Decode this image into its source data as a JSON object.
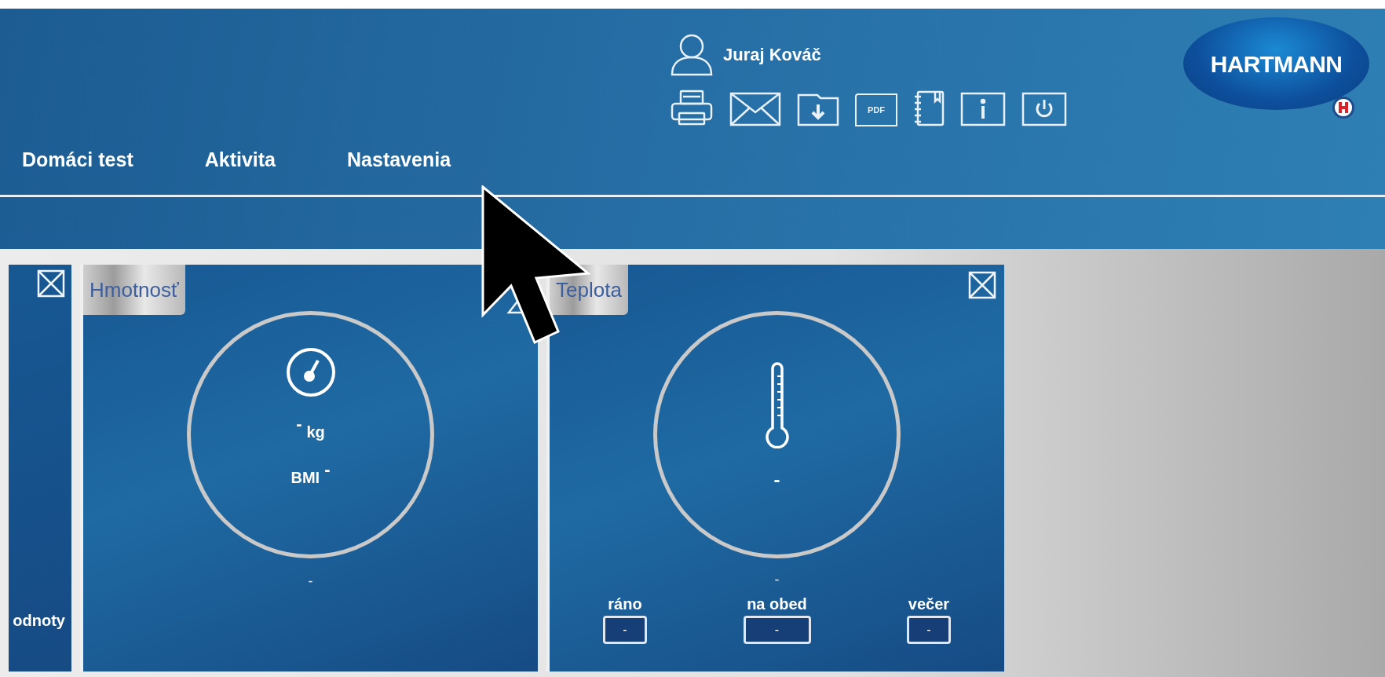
{
  "header": {
    "nav": [
      {
        "label": "Domáci test"
      },
      {
        "label": "Aktivita"
      },
      {
        "label": "Nastavenia"
      }
    ],
    "user": {
      "name": "Juraj Kováč"
    },
    "toolbar": [
      {
        "kind": "print"
      },
      {
        "kind": "mail"
      },
      {
        "kind": "download"
      },
      {
        "kind": "pdf",
        "label": "PDF"
      },
      {
        "kind": "notebook"
      },
      {
        "kind": "info"
      },
      {
        "kind": "power"
      }
    ],
    "logo": {
      "text": "HARTMANN"
    }
  },
  "cards": [
    {
      "kind": "partial",
      "footer": "odnoty"
    },
    {
      "kind": "weight",
      "title": "Hmotnosť",
      "value": "-",
      "unit": "kg",
      "bmi_label": "BMI",
      "bmi_value": "-",
      "trend": "-"
    },
    {
      "kind": "temperature",
      "title": "Teplota",
      "value": "-",
      "trend": "-",
      "readings": [
        {
          "label": "ráno",
          "value": "-"
        },
        {
          "label": "na obed",
          "value": "-"
        },
        {
          "label": "večer",
          "value": "-"
        }
      ]
    }
  ]
}
